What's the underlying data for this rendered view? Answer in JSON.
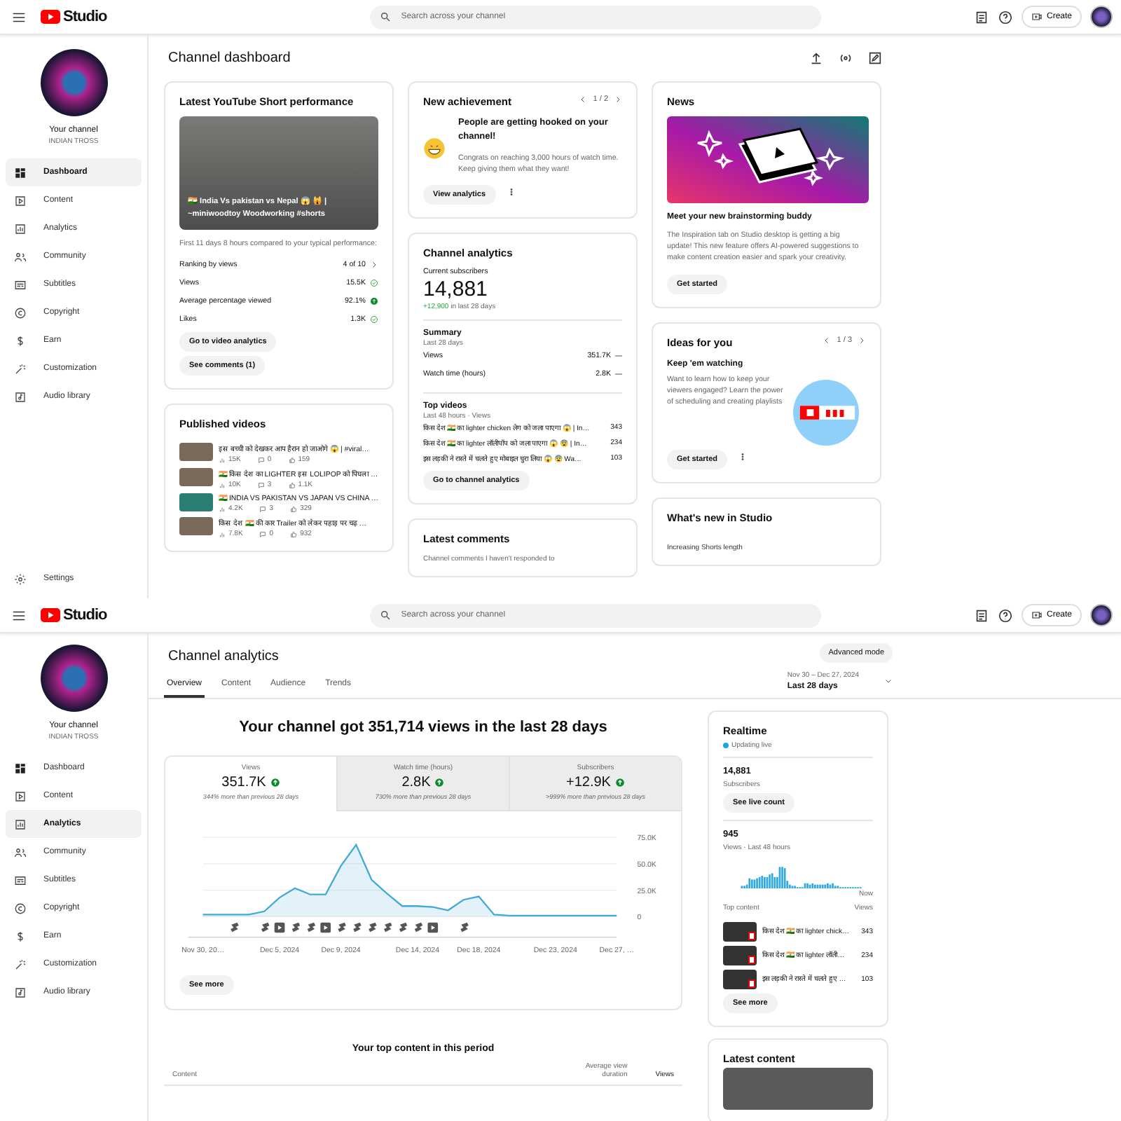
{
  "screens": [
    {
      "kind": "dashboard",
      "header": {
        "logo_text": "Studio",
        "search_placeholder": "Search across your channel",
        "create_label": "Create"
      },
      "sidebar": {
        "channel_label": "Your channel",
        "channel_name": "INDIAN TROSS",
        "items": [
          {
            "kind": "dashboard",
            "label": "Dashboard",
            "selected": true
          },
          {
            "kind": "content",
            "label": "Content",
            "selected": false
          },
          {
            "kind": "analytics",
            "label": "Analytics",
            "selected": false
          },
          {
            "kind": "community",
            "label": "Community",
            "selected": false
          },
          {
            "kind": "subtitles",
            "label": "Subtitles",
            "selected": false
          },
          {
            "kind": "copyright",
            "label": "Copyright",
            "selected": false
          },
          {
            "kind": "earn",
            "label": "Earn",
            "selected": false
          },
          {
            "kind": "customization",
            "label": "Customization",
            "selected": false
          },
          {
            "kind": "audio",
            "label": "Audio library",
            "selected": false
          }
        ],
        "settings_label": "Settings"
      },
      "page_title": "Channel dashboard",
      "short_performance": {
        "title": "Latest YouTube Short performance",
        "video_caption": "🇮🇳 India Vs pakistan vs Nepal 😱 🙀 | ~miniwoodtoy Woodworking #shorts",
        "note": "First 11 days 8 hours compared to your typical performance:",
        "stats": [
          {
            "kind": "rank",
            "label": "Ranking by views",
            "value": "4 of 10"
          },
          {
            "kind": "typical",
            "label": "Views",
            "value": "15.5K"
          },
          {
            "kind": "above",
            "label": "Average percentage viewed",
            "value": "92.1%"
          },
          {
            "kind": "typical",
            "label": "Likes",
            "value": "1.3K"
          }
        ],
        "buttons": [
          "Go to video analytics",
          "See comments (1)"
        ]
      },
      "published_videos": {
        "title": "Published videos",
        "items": [
          {
            "title": "इस बच्ची को देखकर आप हैरान हो जाओगे 😱 | #viral…",
            "views": "15K",
            "comments": "0",
            "likes": "159"
          },
          {
            "title": "🇮🇳 किस देश का LIGHTER इस LOLIPOP को पिघला …",
            "views": "10K",
            "comments": "3",
            "likes": "1.1K"
          },
          {
            "title": "🇮🇳 INDIA VS PAKISTAN VS JAPAN VS CHINA …",
            "views": "4.2K",
            "comments": "3",
            "likes": "329"
          },
          {
            "title": "किस देश 🇮🇳 की कार Trailer को लेकर पहाड़ पर चढ़ …",
            "views": "7.8K",
            "comments": "0",
            "likes": "932"
          }
        ]
      },
      "achievement": {
        "title": "New achievement",
        "pager": "1 / 2",
        "headline": "People are getting hooked on your channel!",
        "body": "Congrats on reaching 3,000 hours of watch time. Keep giving them what they want!",
        "button": "View analytics"
      },
      "channel_analytics": {
        "title": "Channel analytics",
        "subscribers_label": "Current subscribers",
        "subscribers": "14,881",
        "change": "+12,900",
        "change_period": "in last 28 days",
        "summary_title": "Summary",
        "summary_period": "Last 28 days",
        "summary": [
          {
            "label": "Views",
            "value": "351.7K"
          },
          {
            "label": "Watch time (hours)",
            "value": "2.8K"
          }
        ],
        "top_title": "Top videos",
        "top_period": "Last 48 hours · Views",
        "top_videos": [
          {
            "title": "किस देश 🇮🇳 का lighter chicken लेग को जला पाएगा 😱 | In…",
            "views": "343"
          },
          {
            "title": "किस देश 🇮🇳 का lighter लॉलीपॉप को जला पाएगा 😱 😨 | In…",
            "views": "234"
          },
          {
            "title": "इस लड़की ने रास्ते में चलते हुए मोबाइल चुरा लिया 😱 😨 Wa…",
            "views": "103"
          }
        ],
        "button": "Go to channel analytics"
      },
      "latest_comments": {
        "title": "Latest comments",
        "subtitle": "Channel comments I haven't responded to"
      },
      "news": {
        "title": "News",
        "headline": "Meet your new brainstorming buddy",
        "body": "The Inspiration tab on Studio desktop is getting a big update! This new feature offers AI-powered suggestions to make content creation easier and spark your creativity.",
        "button": "Get started"
      },
      "ideas": {
        "title": "Ideas for you",
        "pager": "1 / 3",
        "headline": "Keep 'em watching",
        "body": "Want to learn how to keep your viewers engaged? Learn the power of scheduling and creating playlists",
        "button": "Get started"
      },
      "whats_new": {
        "title": "What's new in Studio",
        "item": "Increasing Shorts length"
      }
    },
    {
      "kind": "analytics",
      "header": {
        "logo_text": "Studio",
        "search_placeholder": "Search across your channel",
        "create_label": "Create"
      },
      "sidebar": {
        "channel_label": "Your channel",
        "channel_name": "INDIAN TROSS",
        "items": [
          {
            "kind": "dashboard",
            "label": "Dashboard",
            "selected": false
          },
          {
            "kind": "content",
            "label": "Content",
            "selected": false
          },
          {
            "kind": "analytics",
            "label": "Analytics",
            "selected": true
          },
          {
            "kind": "community",
            "label": "Community",
            "selected": false
          },
          {
            "kind": "subtitles",
            "label": "Subtitles",
            "selected": false
          },
          {
            "kind": "copyright",
            "label": "Copyright",
            "selected": false
          },
          {
            "kind": "earn",
            "label": "Earn",
            "selected": false
          },
          {
            "kind": "customization",
            "label": "Customization",
            "selected": false
          },
          {
            "kind": "audio",
            "label": "Audio library",
            "selected": false
          }
        ]
      },
      "page_title": "Channel analytics",
      "advanced_button": "Advanced mode",
      "tabs": [
        {
          "label": "Overview",
          "selected": true
        },
        {
          "label": "Content",
          "selected": false
        },
        {
          "label": "Audience",
          "selected": false
        },
        {
          "label": "Trends",
          "selected": false
        }
      ],
      "date_range": "Nov 30 – Dec 27, 2024",
      "period": "Last 28 days",
      "headline": "Your channel got 351,714 views in the last 28 days",
      "metrics": [
        {
          "label": "Views",
          "value": "351.7K",
          "note": "344% more than previous 28 days",
          "selected": true
        },
        {
          "label": "Watch time (hours)",
          "value": "2.8K",
          "note": "730% more than previous 28 days",
          "selected": false
        },
        {
          "label": "Subscribers",
          "value": "+12.9K",
          "note": ">999% more than previous 28 days",
          "selected": false
        }
      ],
      "chart_data": {
        "type": "area",
        "categories": [
          "Nov 30, 20…",
          null,
          null,
          null,
          null,
          "Dec 5, 2024",
          null,
          null,
          null,
          "Dec 9, 2024",
          null,
          null,
          null,
          null,
          "Dec 14, 2024",
          null,
          null,
          null,
          "Dec 18, 2024",
          null,
          null,
          null,
          null,
          "Dec 23, 2024",
          null,
          null,
          null,
          "Dec 27, …"
        ],
        "series": [
          {
            "color": "#41a9d8",
            "values": [
              2000,
              2000,
              2000,
              2000,
              5000,
              18000,
              27000,
              21000,
              21000,
              48000,
              68000,
              35000,
              22000,
              10000,
              10000,
              9000,
              6000,
              16000,
              19000,
              2000,
              1000,
              1000,
              1000,
              1000,
              1000,
              1000,
              1000,
              1000
            ]
          }
        ],
        "ylim": [
          0,
          75000
        ],
        "yticks": [
          {
            "value": 0,
            "label": "0"
          },
          {
            "value": 25000,
            "label": "25.0K"
          },
          {
            "value": 50000,
            "label": "50.0K"
          },
          {
            "value": 75000,
            "label": "75.0K"
          }
        ]
      },
      "upload_markers": [
        {
          "kind": "none"
        },
        {
          "kind": "none"
        },
        {
          "kind": "short"
        },
        {
          "kind": "none"
        },
        {
          "kind": "short"
        },
        {
          "kind": "video"
        },
        {
          "kind": "short"
        },
        {
          "kind": "short"
        },
        {
          "kind": "video"
        },
        {
          "kind": "short"
        },
        {
          "kind": "short"
        },
        {
          "kind": "short"
        },
        {
          "kind": "short"
        },
        {
          "kind": "short"
        },
        {
          "kind": "short"
        },
        {
          "kind": "video"
        },
        {
          "kind": "none"
        },
        {
          "kind": "short"
        }
      ],
      "see_more": "See more",
      "top_content": {
        "title": "Your top content in this period",
        "columns": [
          "Content",
          "Average view duration",
          "Views"
        ]
      },
      "realtime": {
        "title": "Realtime",
        "status": "Updating live",
        "subscribers": "14,881",
        "subscribers_label": "Subscribers",
        "live_button": "See live count",
        "views": "945",
        "views_label": "Views · Last 48 hours",
        "now_label": "Now",
        "list_label": "Top content",
        "list_value_label": "Views",
        "items": [
          {
            "title": "किस देश 🇮🇳 का lighter chick…",
            "views": "343"
          },
          {
            "title": "किस देश 🇮🇳 का lighter लॉली…",
            "views": "234"
          },
          {
            "title": "इस लड़की ने रास्ते में चलते हुए …",
            "views": "103"
          }
        ],
        "button": "See more"
      },
      "latest_content": {
        "title": "Latest content"
      }
    }
  ]
}
